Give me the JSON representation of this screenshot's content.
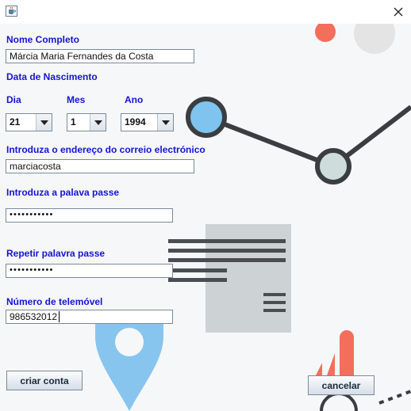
{
  "window": {
    "icon": "java-cup-icon",
    "close_icon": "close-icon"
  },
  "form": {
    "full_name": {
      "label": "Nome Completo",
      "value": "Márcia Maria Fernandes da Costa"
    },
    "birth_date": {
      "label": "Data de Nascimento",
      "day": {
        "label": "Dia",
        "value": "21"
      },
      "month": {
        "label": "Mes",
        "value": "1"
      },
      "year": {
        "label": "Ano",
        "value": "1994"
      }
    },
    "email": {
      "label": "Introduza o endereço do correio electrónico",
      "value": "marciacosta"
    },
    "password": {
      "label": "Introduza a palava passe",
      "value": "•••••••••••"
    },
    "password_repeat": {
      "label": "Repetir palavra passe",
      "value": "•••••••••••"
    },
    "phone": {
      "label": "Número de telemóvel",
      "value": "986532012"
    }
  },
  "buttons": {
    "create": "criar conta",
    "cancel": "cancelar"
  },
  "colors": {
    "label": "#1515d6",
    "accent_blue": "#7fc4ef",
    "accent_coral": "#f46e5c",
    "dark_gray": "#3a3d42",
    "doc_gray": "#cdd3d4"
  }
}
